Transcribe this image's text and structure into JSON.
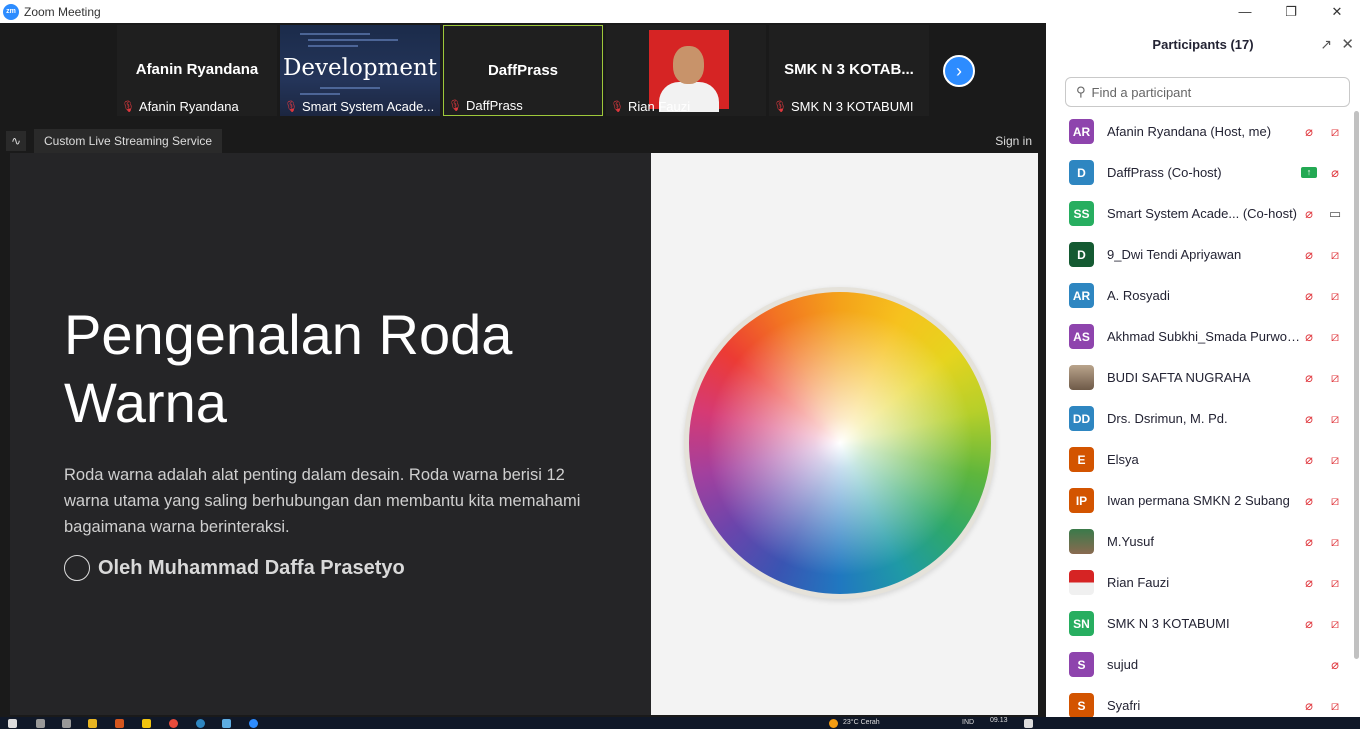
{
  "window": {
    "title": "Zoom Meeting",
    "logo": "zm"
  },
  "thumbnails": [
    {
      "big_name": "Afanin Ryandana",
      "label": "Afanin Ryandana",
      "muted": true,
      "type": "name"
    },
    {
      "big_name": "Development",
      "label": "Smart System Acade...",
      "muted": true,
      "type": "code"
    },
    {
      "big_name": "DaffPrass",
      "label": "DaffPrass",
      "muted": true,
      "type": "name",
      "active": true
    },
    {
      "big_name": "",
      "label": "Rian Fauzi",
      "muted": true,
      "type": "photo"
    },
    {
      "big_name": "SMK N 3 KOTAB...",
      "label": "SMK N 3 KOTABUMI",
      "muted": true,
      "type": "name"
    }
  ],
  "stream": {
    "label": "Custom Live Streaming Service",
    "signin": "Sign in"
  },
  "slide": {
    "title": "Pengenalan Roda Warna",
    "body": "Roda warna adalah alat penting dalam desain. Roda warna berisi 12 warna utama yang saling berhubungan dan membantu kita memahami bagaimana warna berinteraksi.",
    "author": "Oleh Muhammad Daffa Prasetyo"
  },
  "panel": {
    "title": "Participants (17)",
    "search_placeholder": "Find a participant",
    "participants": [
      {
        "initials": "AR",
        "name": "Afanin Ryandana (Host, me)",
        "color": "#8e44ad",
        "status": "muted-novideo"
      },
      {
        "initials": "D",
        "name": "DaffPrass (Co-host)",
        "color": "#2e86c1",
        "status": "share-muted"
      },
      {
        "initials": "SS",
        "name": "Smart System Acade...  (Co-host)",
        "color": "#27ae60",
        "status": "muted-video",
        "wide": true
      },
      {
        "initials": "D",
        "name": "9_Dwi Tendi Apriyawan",
        "color": "#145a32",
        "status": "muted-novideo"
      },
      {
        "initials": "AR",
        "name": "A. Rosyadi",
        "color": "#2e86c1",
        "status": "muted-novideo"
      },
      {
        "initials": "AS",
        "name": "Akhmad Subkhi_Smada Purwok...",
        "color": "#8e44ad",
        "status": "muted-novideo"
      },
      {
        "initials": "",
        "name": "BUDI SAFTA NUGRAHA",
        "color": "",
        "photo": "photo1",
        "status": "muted-novideo"
      },
      {
        "initials": "DD",
        "name": "Drs. Dsrimun, M. Pd.",
        "color": "#2e86c1",
        "status": "muted-novideo"
      },
      {
        "initials": "E",
        "name": "Elsya",
        "color": "#d35400",
        "status": "muted-novideo"
      },
      {
        "initials": "IP",
        "name": "Iwan permana SMKN 2 Subang",
        "color": "#d35400",
        "status": "muted-novideo"
      },
      {
        "initials": "",
        "name": "M.Yusuf",
        "color": "",
        "photo": "photo2",
        "status": "muted-novideo"
      },
      {
        "initials": "",
        "name": "Rian Fauzi",
        "color": "",
        "photo": "photo3",
        "status": "muted-novideo"
      },
      {
        "initials": "SN",
        "name": "SMK N 3 KOTABUMI",
        "color": "#27ae60",
        "status": "muted-novideo"
      },
      {
        "initials": "S",
        "name": "sujud",
        "color": "#8e44ad",
        "status": "novideo-only"
      },
      {
        "initials": "S",
        "name": "Syafri",
        "color": "#d35400",
        "status": "muted-novideo"
      }
    ]
  },
  "taskbar": {
    "weather": "23°C  Cerah",
    "lang": "IND",
    "time": "09.13"
  }
}
